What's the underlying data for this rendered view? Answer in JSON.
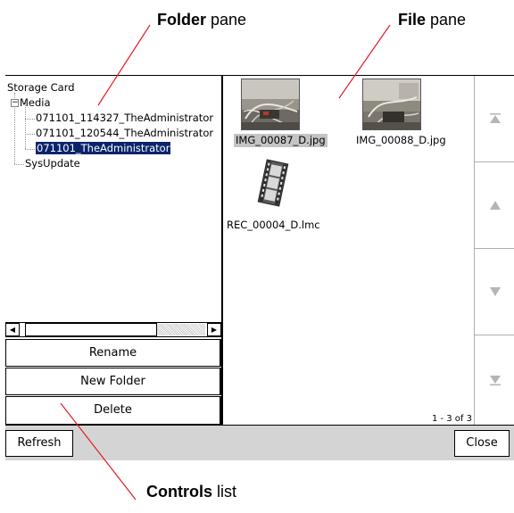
{
  "callouts": {
    "folder": {
      "bold": "Folder",
      "rest": " pane"
    },
    "file": {
      "bold": "File",
      "rest": " pane"
    },
    "controls": {
      "bold": "Controls",
      "rest": " list"
    }
  },
  "tree": {
    "root": "Storage Card",
    "media": "Media",
    "children": [
      "071101_114327_TheAdministrator",
      "071101_120544_TheAdministrator",
      "071101_TheAdministrator"
    ],
    "sysupdate": "SysUpdate"
  },
  "controls": {
    "rename": "Rename",
    "new_folder": "New Folder",
    "delete": "Delete"
  },
  "files": [
    {
      "name": "IMG_00087_D.jpg",
      "kind": "photo"
    },
    {
      "name": "IMG_00088_D.jpg",
      "kind": "photo"
    },
    {
      "name": "REC_00004_D.lmc",
      "kind": "film-icon"
    }
  ],
  "file_count": "1 - 3 of 3",
  "nav": [
    "scroll-top-icon",
    "scroll-up-icon",
    "scroll-down-icon",
    "scroll-bottom-icon"
  ],
  "toolbar": {
    "refresh": "Refresh",
    "close": "Close"
  },
  "colors": {
    "selection": "#0a246a",
    "file_selection": "#c4c4c4",
    "toolbar_bg": "#d4d4d4",
    "callout_line": "#e31b23"
  }
}
